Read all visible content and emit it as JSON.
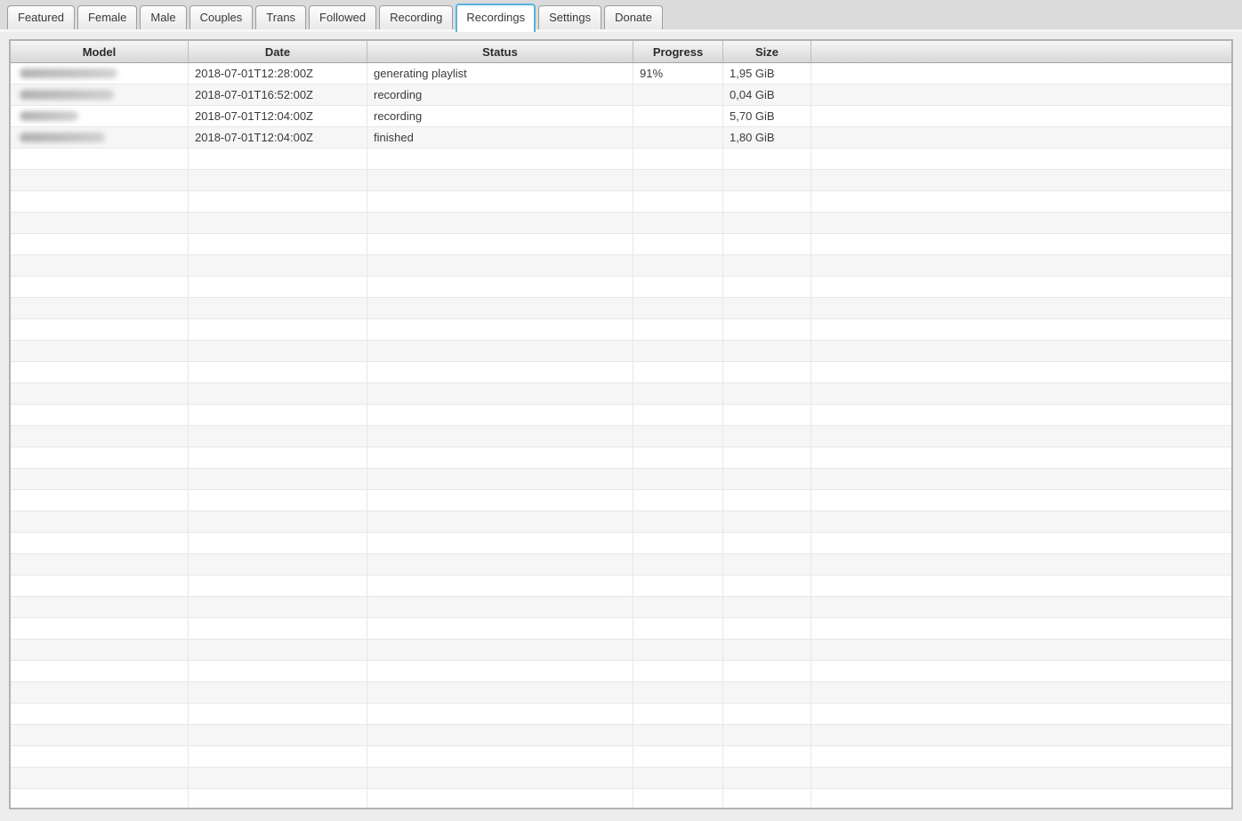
{
  "tabs": {
    "items": [
      {
        "label": "Featured",
        "active": false
      },
      {
        "label": "Female",
        "active": false
      },
      {
        "label": "Male",
        "active": false
      },
      {
        "label": "Couples",
        "active": false
      },
      {
        "label": "Trans",
        "active": false
      },
      {
        "label": "Followed",
        "active": false
      },
      {
        "label": "Recording",
        "active": false
      },
      {
        "label": "Recordings",
        "active": true
      },
      {
        "label": "Settings",
        "active": false
      },
      {
        "label": "Donate",
        "active": false
      }
    ]
  },
  "table": {
    "columns": [
      {
        "label": "Model"
      },
      {
        "label": "Date"
      },
      {
        "label": "Status"
      },
      {
        "label": "Progress"
      },
      {
        "label": "Size"
      },
      {
        "label": ""
      }
    ],
    "rows": [
      {
        "model_redacted": true,
        "model_blur_width": 110,
        "date": "2018-07-01T12:28:00Z",
        "status": "generating playlist",
        "progress": "91%",
        "size": "1,95 GiB"
      },
      {
        "model_redacted": true,
        "model_blur_width": 106,
        "date": "2018-07-01T16:52:00Z",
        "status": "recording",
        "progress": "",
        "size": "0,04 GiB"
      },
      {
        "model_redacted": true,
        "model_blur_width": 66,
        "date": "2018-07-01T12:04:00Z",
        "status": "recording",
        "progress": "",
        "size": "5,70 GiB"
      },
      {
        "model_redacted": true,
        "model_blur_width": 96,
        "date": "2018-07-01T12:04:00Z",
        "status": "finished",
        "progress": "",
        "size": "1,80 GiB"
      }
    ],
    "empty_row_count": 31
  },
  "colors": {
    "accent": "#58b2e0",
    "page_bg": "#ededed",
    "tabstrip_bg": "#dbdbdb",
    "table_border": "#b2b2b2",
    "header_top": "#f5f5f5",
    "header_bottom": "#d8d8d8",
    "stripe": "#f6f6f6",
    "grid_line": "#e7e7e7",
    "text": "#3a3a3a"
  }
}
